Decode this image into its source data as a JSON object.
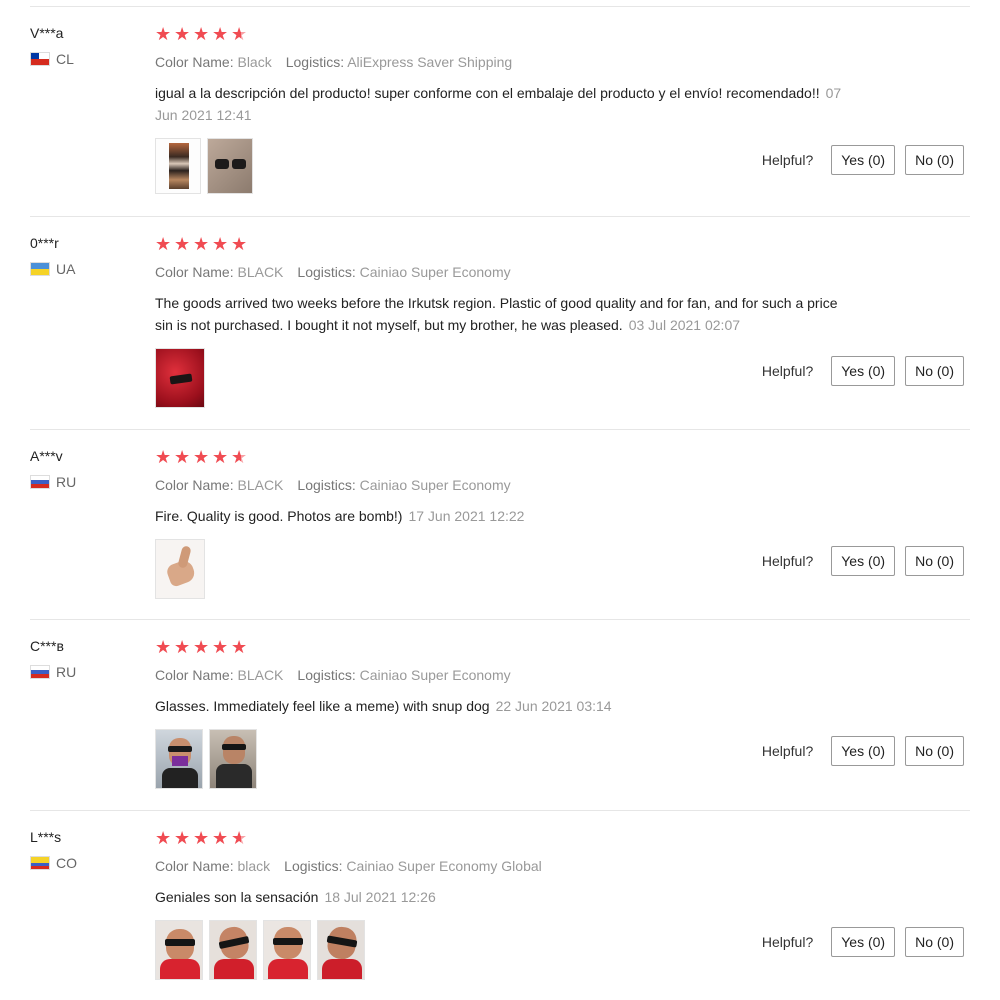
{
  "ui": {
    "helpful_label": "Helpful?",
    "yes_label": "Yes (0)",
    "no_label": "No (0)"
  },
  "colors": {
    "star": "#f04b52",
    "meta_text": "#999999",
    "divider": "#e6e6e6"
  },
  "reviews": [
    {
      "user": "V***a",
      "country": "CL",
      "rating": 4.5,
      "color_label": "Color Name:",
      "color_value": "Black",
      "logistics_label": "Logistics:",
      "logistics_value": "AliExpress Saver Shipping",
      "text": "igual a la descripción del producto! super conforme con el embalaje del producto y el envío! recomendado!!",
      "date": "07 Jun 2021 12:41",
      "photos": [
        "box-photo",
        "sunglasses-photo"
      ]
    },
    {
      "user": "0***r",
      "country": "UA",
      "rating": 5,
      "color_label": "Color Name:",
      "color_value": "BLACK",
      "logistics_label": "Logistics:",
      "logistics_value": "Cainiao Super Economy",
      "text": "The goods arrived two weeks before the Irkutsk region. Plastic of good quality and for fan, and for such a price sin is not purchased. I bought it not myself, but my brother, he was pleased.",
      "date": "03 Jul 2021 02:07",
      "photos": [
        "red-fabric-photo"
      ]
    },
    {
      "user": "A***v",
      "country": "RU",
      "rating": 4.5,
      "color_label": "Color Name:",
      "color_value": "BLACK",
      "logistics_label": "Logistics:",
      "logistics_value": "Cainiao Super Economy",
      "text": "Fire. Quality is good. Photos are bomb!)",
      "date": "17 Jun 2021 12:22",
      "photos": [
        "thumbs-up-photo"
      ]
    },
    {
      "user": "C***в",
      "country": "RU",
      "rating": 5,
      "color_label": "Color Name:",
      "color_value": "BLACK",
      "logistics_label": "Logistics:",
      "logistics_value": "Cainiao Super Economy",
      "text": "Glasses. Immediately feel like a meme) with snup dog",
      "date": "22 Jun 2021 03:14",
      "photos": [
        "selfie-photo-1",
        "selfie-photo-2"
      ]
    },
    {
      "user": "L***s",
      "country": "CO",
      "rating": 4.5,
      "color_label": "Color Name:",
      "color_value": "black",
      "logistics_label": "Logistics:",
      "logistics_value": "Cainiao Super Economy Global",
      "text": "Geniales son la sensación",
      "date": "18 Jul 2021 12:26",
      "photos": [
        "selfie-photo-a",
        "selfie-photo-b",
        "selfie-photo-c",
        "selfie-photo-d"
      ]
    }
  ]
}
